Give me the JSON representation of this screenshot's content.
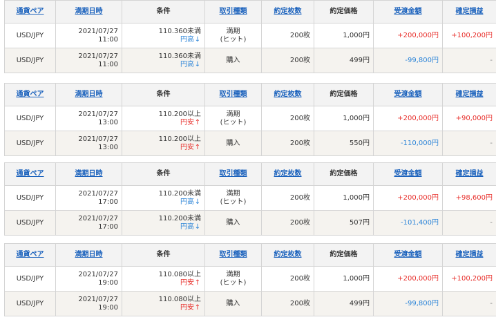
{
  "headers": [
    "通貨ペア",
    "満期日時",
    "条件",
    "取引種類",
    "約定枚数",
    "約定価格",
    "受渡金額",
    "確定損益"
  ],
  "header_links": [
    true,
    true,
    false,
    true,
    true,
    false,
    true,
    true
  ],
  "colors": {
    "link": "#1b62bd",
    "positive": "#e8322e",
    "negative": "#2f86d8",
    "alt_row": "#f5f3ef",
    "header_bg": "#f3f3f3"
  },
  "icons": {
    "up": "up-arrow-icon",
    "down": "down-arrow-icon"
  },
  "blocks": [
    {
      "rows": [
        {
          "pair": "USD/JPY",
          "date": "2021/07/27",
          "time": "11:00",
          "cond_price": "110.360未満",
          "cond_dir": "円高",
          "cond_arrow": "↓",
          "cond_type": "down",
          "trade": [
            "満期",
            "(ヒット)"
          ],
          "qty": "200枚",
          "price": "1,000円",
          "amount": "+200,000円",
          "amount_sign": "pos",
          "pnl": "+100,200円",
          "pnl_sign": "pos"
        },
        {
          "pair": "USD/JPY",
          "date": "2021/07/27",
          "time": "11:00",
          "cond_price": "110.360未満",
          "cond_dir": "円高",
          "cond_arrow": "↓",
          "cond_type": "down",
          "trade": [
            "購入"
          ],
          "qty": "200枚",
          "price": "499円",
          "amount": "-99,800円",
          "amount_sign": "neg",
          "pnl": "-",
          "pnl_sign": "dash"
        }
      ]
    },
    {
      "rows": [
        {
          "pair": "USD/JPY",
          "date": "2021/07/27",
          "time": "13:00",
          "cond_price": "110.200以上",
          "cond_dir": "円安",
          "cond_arrow": "↑",
          "cond_type": "up",
          "trade": [
            "満期",
            "(ヒット)"
          ],
          "qty": "200枚",
          "price": "1,000円",
          "amount": "+200,000円",
          "amount_sign": "pos",
          "pnl": "+90,000円",
          "pnl_sign": "pos"
        },
        {
          "pair": "USD/JPY",
          "date": "2021/07/27",
          "time": "13:00",
          "cond_price": "110.200以上",
          "cond_dir": "円安",
          "cond_arrow": "↑",
          "cond_type": "up",
          "trade": [
            "購入"
          ],
          "qty": "200枚",
          "price": "550円",
          "amount": "-110,000円",
          "amount_sign": "neg",
          "pnl": "-",
          "pnl_sign": "dash"
        }
      ]
    },
    {
      "rows": [
        {
          "pair": "USD/JPY",
          "date": "2021/07/27",
          "time": "17:00",
          "cond_price": "110.200未満",
          "cond_dir": "円高",
          "cond_arrow": "↓",
          "cond_type": "down",
          "trade": [
            "満期",
            "(ヒット)"
          ],
          "qty": "200枚",
          "price": "1,000円",
          "amount": "+200,000円",
          "amount_sign": "pos",
          "pnl": "+98,600円",
          "pnl_sign": "pos"
        },
        {
          "pair": "USD/JPY",
          "date": "2021/07/27",
          "time": "17:00",
          "cond_price": "110.200未満",
          "cond_dir": "円高",
          "cond_arrow": "↓",
          "cond_type": "down",
          "trade": [
            "購入"
          ],
          "qty": "200枚",
          "price": "507円",
          "amount": "-101,400円",
          "amount_sign": "neg",
          "pnl": "-",
          "pnl_sign": "dash"
        }
      ]
    },
    {
      "rows": [
        {
          "pair": "USD/JPY",
          "date": "2021/07/27",
          "time": "19:00",
          "cond_price": "110.080以上",
          "cond_dir": "円安",
          "cond_arrow": "↑",
          "cond_type": "up",
          "trade": [
            "満期",
            "(ヒット)"
          ],
          "qty": "200枚",
          "price": "1,000円",
          "amount": "+200,000円",
          "amount_sign": "pos",
          "pnl": "+100,200円",
          "pnl_sign": "pos"
        },
        {
          "pair": "USD/JPY",
          "date": "2021/07/27",
          "time": "19:00",
          "cond_price": "110.080以上",
          "cond_dir": "円安",
          "cond_arrow": "↑",
          "cond_type": "up",
          "trade": [
            "購入"
          ],
          "qty": "200枚",
          "price": "499円",
          "amount": "-99,800円",
          "amount_sign": "neg",
          "pnl": "-",
          "pnl_sign": "dash"
        }
      ]
    }
  ]
}
